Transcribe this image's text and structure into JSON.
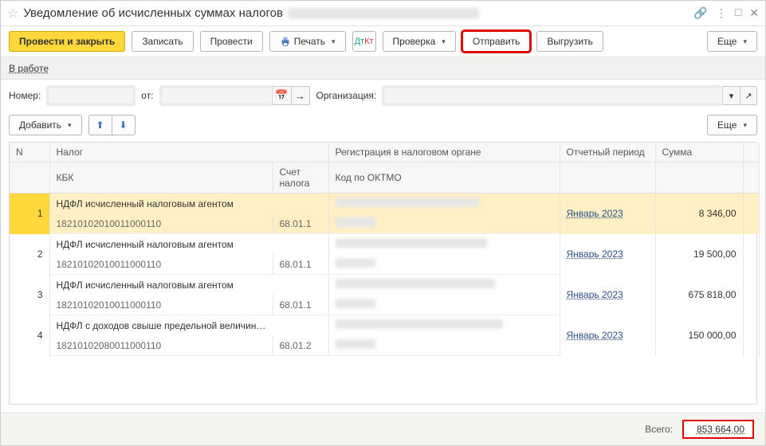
{
  "title": "Уведомление об исчисленных суммах налогов",
  "toolbar": {
    "post_close": "Провести и закрыть",
    "save": "Записать",
    "post": "Провести",
    "print": "Печать",
    "check": "Проверка",
    "send": "Отправить",
    "export": "Выгрузить",
    "more": "Еще"
  },
  "inwork_label": "В работе",
  "fields": {
    "number_label": "Номер:",
    "ot_label": "от:",
    "org_label": "Организация:"
  },
  "toolbar2": {
    "add": "Добавить",
    "more": "Еще"
  },
  "table": {
    "headers": {
      "n": "N",
      "nalog": "Налог",
      "reg": "Регистрация в налоговом органе",
      "period": "Отчетный период",
      "sum": "Сумма",
      "kbk": "КБК",
      "account": "Счет налога",
      "oktmo": "Код по ОКТМО"
    },
    "rows": [
      {
        "n": "1",
        "nalog": "НДФЛ исчисленный налоговым агентом",
        "kbk": "18210102010011000110",
        "account": "68.01.1",
        "period": "Январь 2023",
        "sum": "8 346,00"
      },
      {
        "n": "2",
        "nalog": "НДФЛ исчисленный налоговым агентом",
        "kbk": "18210102010011000110",
        "account": "68.01.1",
        "period": "Январь 2023",
        "sum": "19 500,00"
      },
      {
        "n": "3",
        "nalog": "НДФЛ исчисленный налоговым агентом",
        "kbk": "18210102010011000110",
        "account": "68.01.1",
        "period": "Январь 2023",
        "sum": "675 818,00"
      },
      {
        "n": "4",
        "nalog": "НДФЛ с доходов свыше предельной величин…",
        "kbk": "18210102080011000110",
        "account": "68.01.2",
        "period": "Январь 2023",
        "sum": "150 000,00"
      }
    ]
  },
  "footer": {
    "total_label": "Всего:",
    "total_value": "853 664,00"
  }
}
